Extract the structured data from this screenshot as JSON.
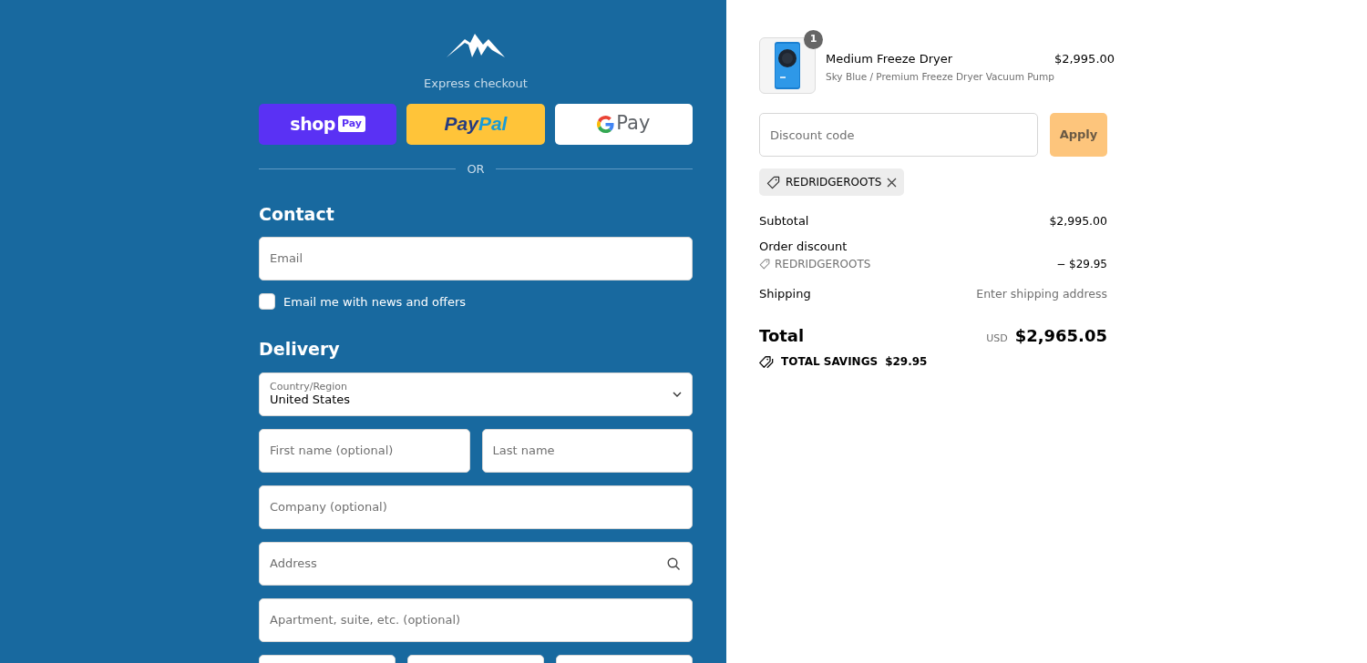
{
  "express_checkout": {
    "label": "Express checkout",
    "buttons": [
      {
        "kind": "shop",
        "text": "shop",
        "badge": "Pay"
      },
      {
        "kind": "paypal",
        "text": "Pay",
        "text_2": "Pal"
      },
      {
        "kind": "gpay",
        "text": "Pay"
      }
    ],
    "divider": "OR"
  },
  "contact": {
    "heading": "Contact",
    "email": {
      "placeholder": "Email"
    },
    "newsletter": {
      "label": "Email me with news and offers",
      "checked": false
    }
  },
  "delivery": {
    "heading": "Delivery",
    "rows": [
      [
        {
          "kind": "select",
          "label": "Country/Region",
          "value": "United States"
        }
      ],
      [
        {
          "kind": "text",
          "placeholder": "First name (optional)"
        },
        {
          "kind": "text",
          "placeholder": "Last name"
        }
      ],
      [
        {
          "kind": "text",
          "placeholder": "Company (optional)"
        }
      ],
      [
        {
          "kind": "search",
          "placeholder": "Address"
        }
      ],
      [
        {
          "kind": "text",
          "placeholder": "Apartment, suite, etc. (optional)"
        }
      ],
      [
        {
          "kind": "text"
        },
        {
          "kind": "text"
        },
        {
          "kind": "text"
        }
      ]
    ]
  },
  "cart": {
    "items": [
      {
        "name": "Medium Freeze Dryer",
        "variant": "Sky Blue / Premium Freeze Dryer Vacuum Pump",
        "price": "$2,995.00",
        "quantity": "1"
      }
    ]
  },
  "discount": {
    "placeholder": "Discount code",
    "button": "Apply",
    "applied": "REDRIDGEROOTS"
  },
  "summary": {
    "lines": [
      {
        "kind": "plain",
        "label": "Subtotal",
        "value": "$2,995.00"
      },
      {
        "kind": "heading",
        "label": "Order discount"
      },
      {
        "kind": "code",
        "label": "REDRIDGEROOTS",
        "value": "− $29.95"
      },
      {
        "kind": "muted",
        "label": "Shipping",
        "value": "Enter shipping address"
      }
    ],
    "total": {
      "label": "Total",
      "currency": "USD",
      "value": "$2,965.05"
    },
    "savings": {
      "label": "TOTAL SAVINGS",
      "value": "$29.95"
    }
  }
}
